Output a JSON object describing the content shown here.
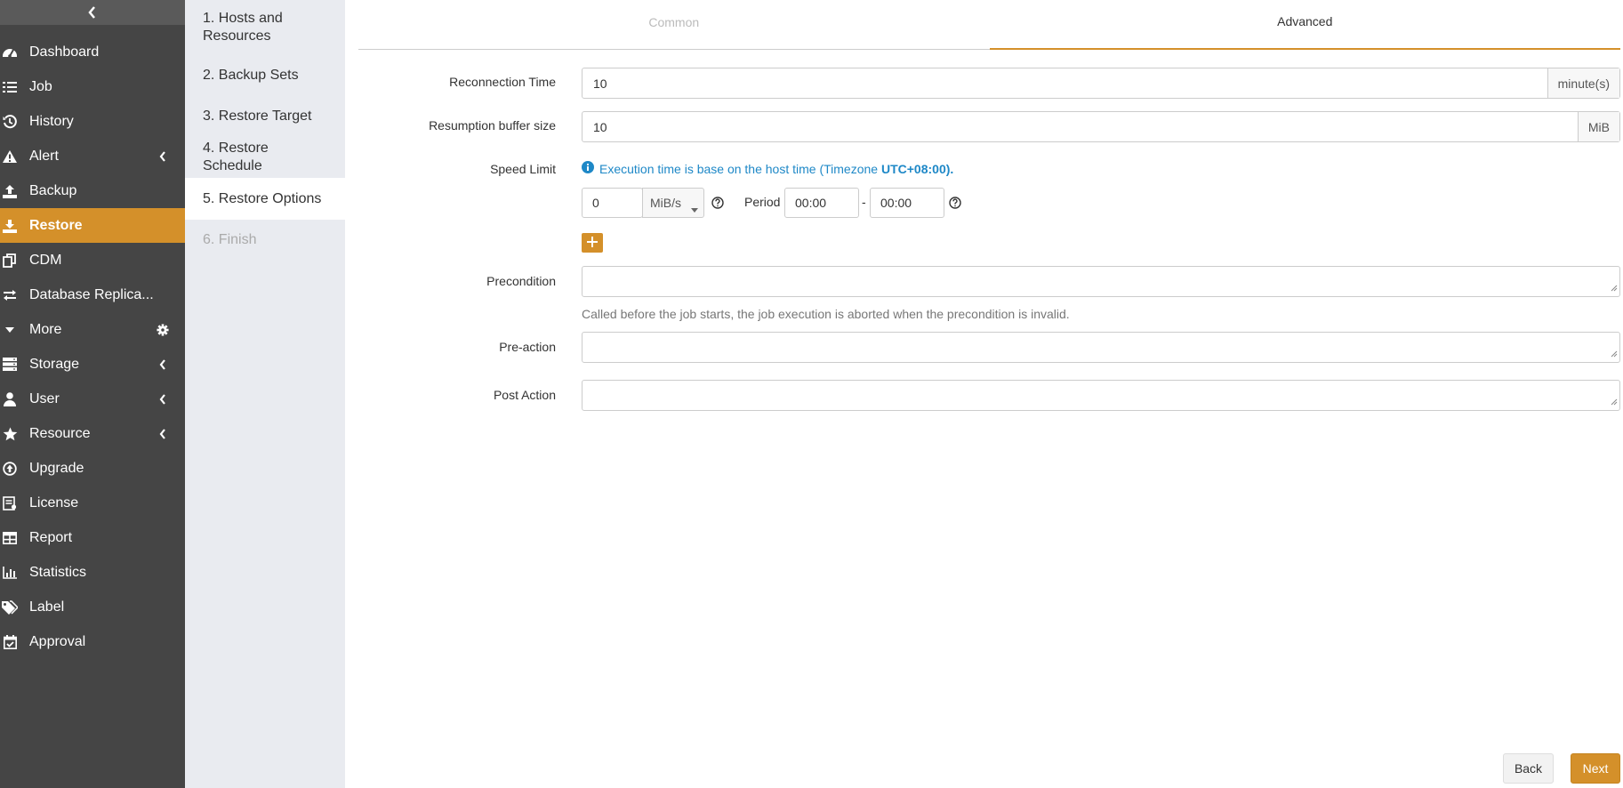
{
  "sidebar": {
    "items": [
      {
        "label": "Dashboard",
        "icon": "dashboard-icon"
      },
      {
        "label": "Job",
        "icon": "list-icon"
      },
      {
        "label": "History",
        "icon": "history-icon"
      },
      {
        "label": "Alert",
        "icon": "warning-icon"
      },
      {
        "label": "Backup",
        "icon": "upload-icon"
      },
      {
        "label": "Restore",
        "icon": "download-icon"
      },
      {
        "label": "CDM",
        "icon": "copy-icon"
      },
      {
        "label": "Database Replica...",
        "icon": "exchange-icon"
      },
      {
        "label": "More",
        "icon": "caret-down-icon"
      },
      {
        "label": "Storage",
        "icon": "server-icon"
      },
      {
        "label": "User",
        "icon": "user-icon"
      },
      {
        "label": "Resource",
        "icon": "star-icon"
      },
      {
        "label": "Upgrade",
        "icon": "upgrade-icon"
      },
      {
        "label": "License",
        "icon": "license-icon"
      },
      {
        "label": "Report",
        "icon": "table-icon"
      },
      {
        "label": "Statistics",
        "icon": "bar-chart-icon"
      },
      {
        "label": "Label",
        "icon": "tags-icon"
      },
      {
        "label": "Approval",
        "icon": "calendar-check-icon"
      }
    ]
  },
  "steps": [
    {
      "line1": "1. Hosts and",
      "line2": "Resources"
    },
    {
      "label": "2. Backup Sets"
    },
    {
      "label": "3. Restore Target"
    },
    {
      "label": "4. Restore Schedule"
    },
    {
      "label": "5. Restore Options"
    },
    {
      "label": "6. Finish"
    }
  ],
  "tabs": {
    "common": "Common",
    "advanced": "Advanced"
  },
  "form": {
    "reconnection": {
      "label": "Reconnection Time",
      "value": "10",
      "unit": "minute(s)"
    },
    "buffer": {
      "label": "Resumption buffer size",
      "value": "10",
      "unit": "MiB"
    },
    "speed": {
      "label": "Speed Limit",
      "info_prefix": "Execution time is base on the host time (Timezone ",
      "info_timezone": "UTC+08:00).",
      "value": "0",
      "unit": "MiB/s",
      "period_label": "Period",
      "start": "00:00",
      "separator": "-",
      "end": "00:00"
    },
    "precondition": {
      "label": "Precondition",
      "value": "",
      "hint": "Called before the job starts, the job execution is aborted when the precondition is invalid."
    },
    "pre_action": {
      "label": "Pre-action",
      "value": ""
    },
    "post_action": {
      "label": "Post Action",
      "value": ""
    }
  },
  "buttons": {
    "back": "Back",
    "next": "Next"
  },
  "colors": {
    "accent": "#d4902a",
    "sidebar_bg": "#454545",
    "info": "#1e88c7"
  }
}
